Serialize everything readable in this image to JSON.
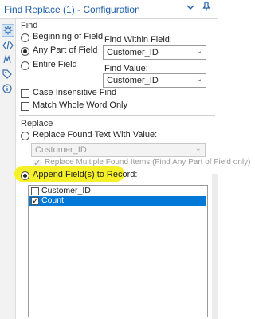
{
  "window": {
    "title": "Find Replace (1) - Configuration",
    "chevron_icon": "chevron-down-icon",
    "pin_icon": "pin-icon"
  },
  "toolbar": {
    "items": [
      "configuration-icon",
      "xml-icon",
      "meta-info-icon",
      "tag-icon",
      "info-icon"
    ],
    "active": "configuration-icon"
  },
  "find": {
    "section_label": "Find",
    "options": [
      {
        "label": "Beginning of Field",
        "selected": false
      },
      {
        "label": "Any Part of Field",
        "selected": true
      },
      {
        "label": "Entire Field",
        "selected": false
      }
    ],
    "find_within_label": "Find Within Field:",
    "find_within_value": "Customer_ID",
    "find_value_label": "Find Value:",
    "find_value_value": "Customer_ID",
    "case_insensitive_label": "Case Insensitive Find",
    "case_insensitive_checked": false,
    "match_whole_label": "Match Whole Word Only",
    "match_whole_checked": false
  },
  "replace": {
    "section_label": "Replace",
    "replace_found_label": "Replace Found Text With Value:",
    "replace_found_selected": false,
    "replace_value": "Customer_ID",
    "replace_multiple_label": "Replace Multiple Found Items (Find Any Part of Field only)",
    "replace_multiple_checked": true,
    "append_label": "Append Field(s) to Record:",
    "append_selected": true,
    "highlight_color": "#f6f028",
    "fields": [
      {
        "label": "Customer_ID",
        "checked": false,
        "selected": false
      },
      {
        "label": "Count",
        "checked": true,
        "selected": true
      }
    ]
  }
}
